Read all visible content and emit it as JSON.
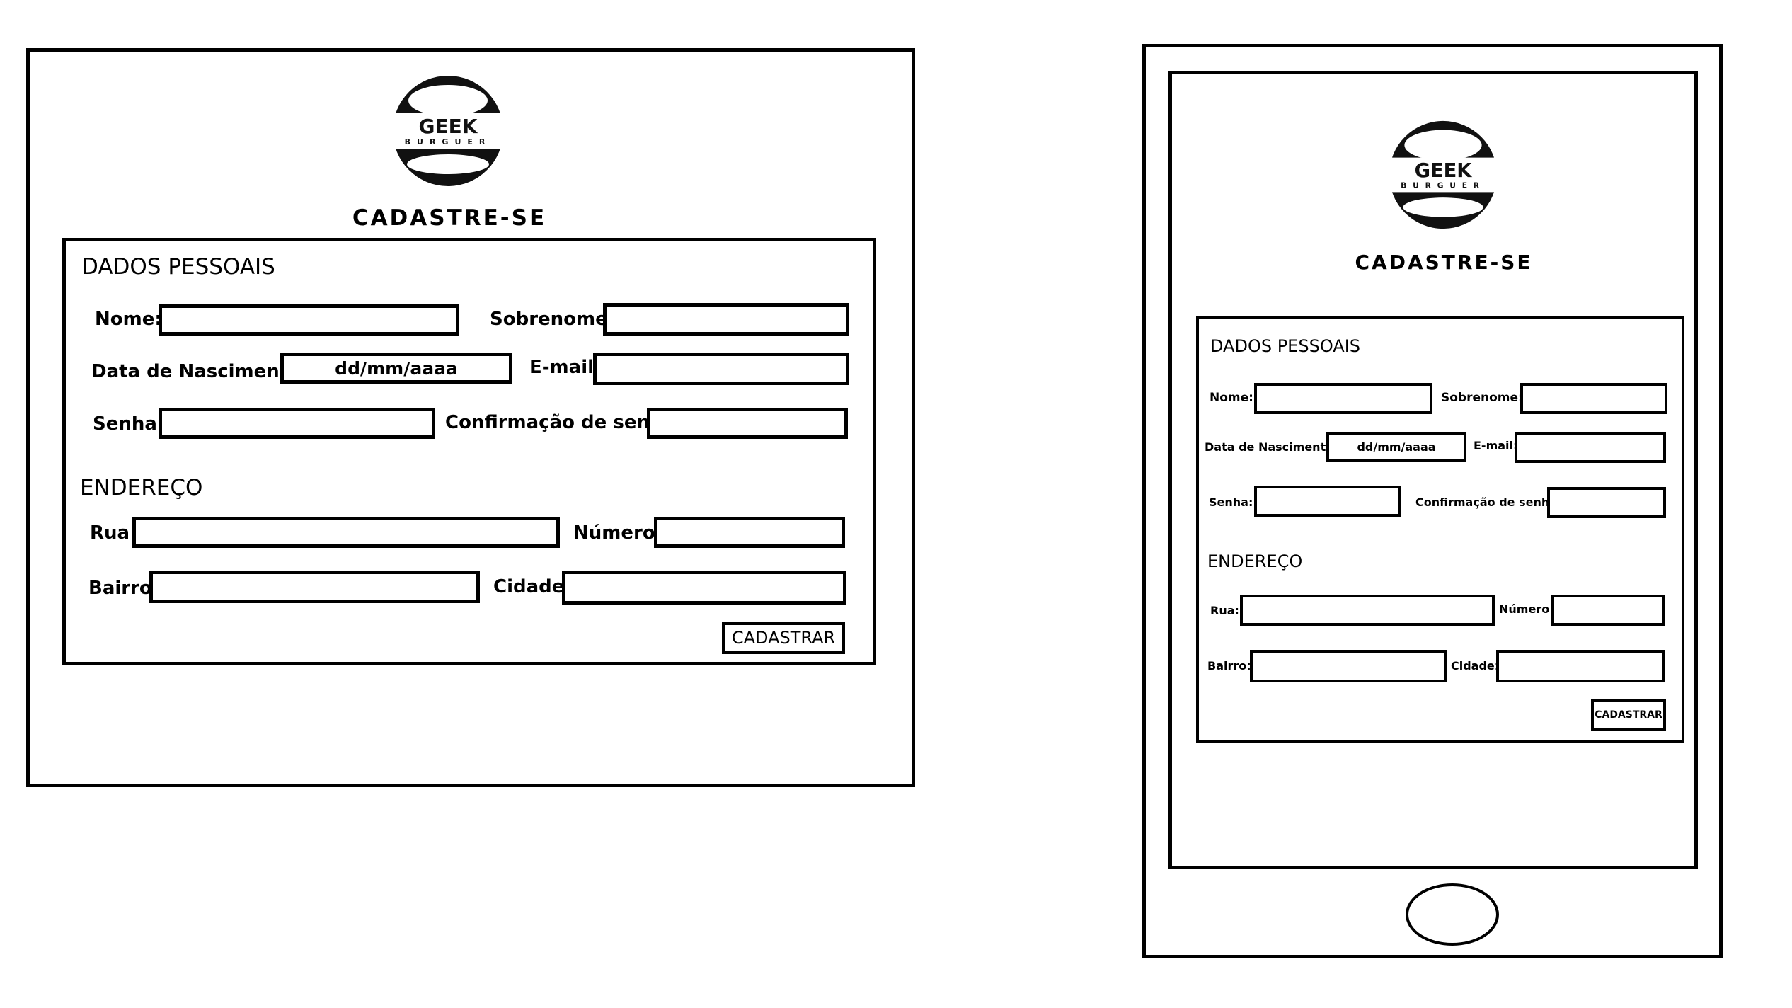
{
  "logo": {
    "word": "GEEK",
    "sub": "BURGUER"
  },
  "title": "CADASTRE-SE",
  "form": {
    "section_personal": "DADOS PESSOAIS",
    "nome_label": "Nome:",
    "sobrenome_label": "Sobrenome:",
    "nascimento_label": "Data de Nascimento:",
    "nascimento_placeholder": "dd/mm/aaaa",
    "email_label": "E-mail:",
    "senha_label": "Senha:",
    "confirmacao_label": "Confirmação de senha:",
    "section_address": "ENDEREÇO",
    "rua_label": "Rua:",
    "numero_label": "Número:",
    "bairro_label": "Bairro:",
    "cidade_label": "Cidade:",
    "submit_label": "CADASTRAR"
  }
}
